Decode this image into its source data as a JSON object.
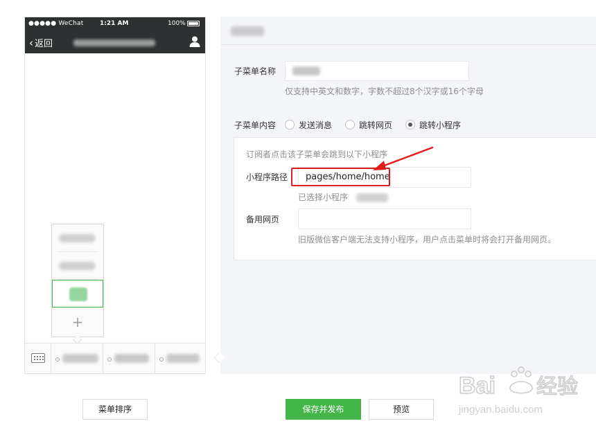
{
  "phone": {
    "status_bar": {
      "carrier": "●●●●● WeChat",
      "time": "1:21 AM",
      "battery": "100%"
    },
    "nav": {
      "back_label": "返回",
      "user_icon": "person-icon"
    },
    "submenu": {
      "add_symbol": "+",
      "items_count_visible": 3
    },
    "bottom_menu": {
      "keyboard_icon": "keyboard-icon"
    }
  },
  "form": {
    "name_label": "子菜单名称",
    "name_hint": "仅支持中英文和数字，字数不超过8个汉字或16个字母",
    "content_label": "子菜单内容",
    "radio_options": [
      {
        "label": "发送消息",
        "selected": false
      },
      {
        "label": "跳转网页",
        "selected": false
      },
      {
        "label": "跳转小程序",
        "selected": true
      }
    ],
    "mini_program": {
      "intro": "订阅者点击该子菜单会跳到以下小程序",
      "path_label": "小程序路径",
      "path_value": "pages/home/home",
      "selected_text": "已选择小程序",
      "backup_label": "备用网页",
      "backup_value": "",
      "backup_hint": "旧版微信客户端无法支持小程序，用户点击菜单时将会打开备用网页。"
    }
  },
  "footer": {
    "sort_button": "菜单排序",
    "save_publish_button": "保存并发布",
    "preview_button": "预览"
  },
  "colors": {
    "primary_green": "#44b549",
    "annotation_red": "#e21b1b",
    "nav_dark": "#2e3132"
  }
}
